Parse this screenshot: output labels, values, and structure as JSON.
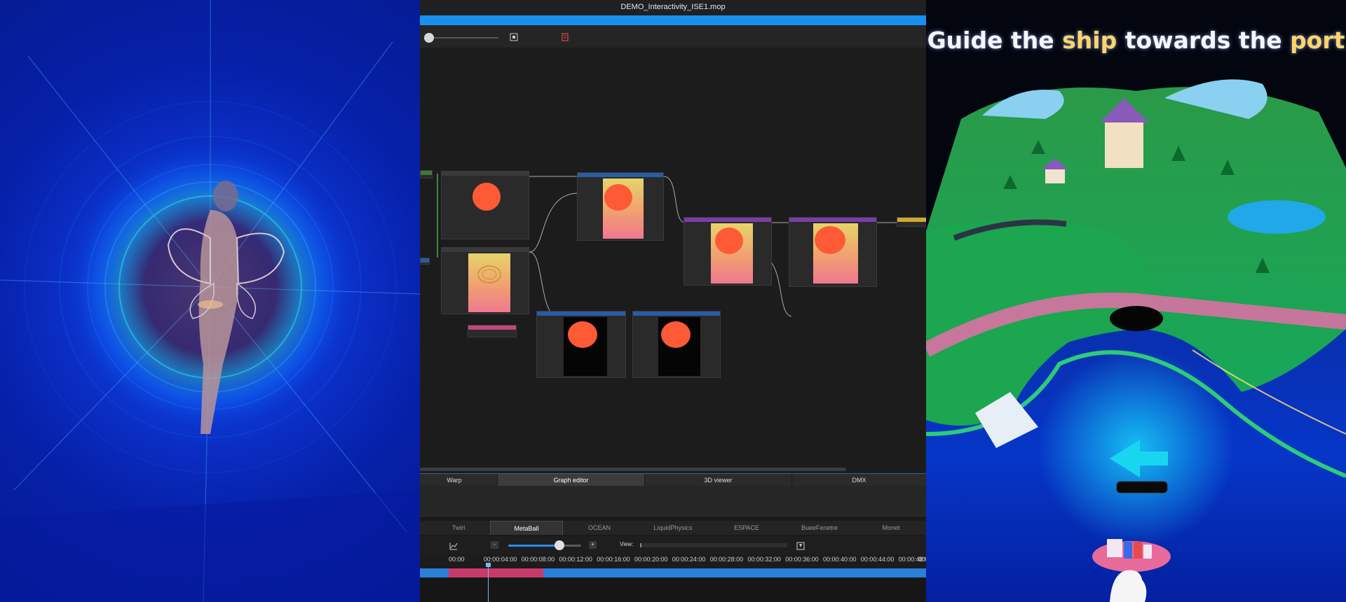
{
  "window": {
    "title": "DEMO_Interactivity_ISE1.mop"
  },
  "toolbar": {
    "fit_icon": "fit-view-icon",
    "delete_icon": "trash-icon"
  },
  "view_tabs": [
    {
      "label": "Warp",
      "active": false
    },
    {
      "label": "Graph editor",
      "active": true
    },
    {
      "label": "3D viewer",
      "active": false
    },
    {
      "label": "DMX",
      "active": false
    }
  ],
  "scene_tabs": [
    {
      "label": "Twirl",
      "active": false
    },
    {
      "label": "MetaBall",
      "active": true
    },
    {
      "label": "OCEAN",
      "active": false
    },
    {
      "label": "LiquidPhysics",
      "active": false
    },
    {
      "label": "ESPACE",
      "active": false
    },
    {
      "label": "BueeFenetre",
      "active": false
    },
    {
      "label": "Monet",
      "active": false
    }
  ],
  "timeline": {
    "minus_label": "-",
    "plus_label": "+",
    "view_label": "View:",
    "ticks": [
      "00:00",
      "00:00:04:00",
      "00:00:08:00",
      "00:00:12:00",
      "00:00:16:00",
      "00:00:20:00",
      "00:00:24:00",
      "00:00:28:00",
      "00:00:32:00",
      "00:00:36:00",
      "00:00:40:00",
      "00:00:44:00",
      "00:00:48:00",
      "00"
    ],
    "zoom_level": 0.7
  },
  "colors": {
    "accent_blue": "#1890f0",
    "clip_pink": "#c83a6a",
    "node_orange_blob": "#ff5a36"
  },
  "right_panel": {
    "headline_parts": [
      {
        "text": "Guide the ",
        "highlight": false
      },
      {
        "text": "ship",
        "highlight": true
      },
      {
        "text": " towards the ",
        "highlight": false
      },
      {
        "text": "port",
        "highlight": true
      }
    ]
  }
}
